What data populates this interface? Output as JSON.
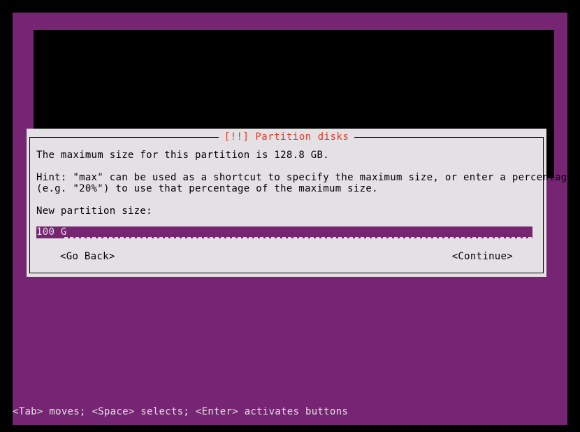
{
  "screen": {
    "background_color": "#762572",
    "frame_color": "#000000"
  },
  "dialog": {
    "title": "[!!] Partition disks",
    "title_color": "#df382c",
    "background_color": "#e4e1e4",
    "text_color": "#000000",
    "body": {
      "line_max_size": "The maximum size for this partition is 128.8 GB.",
      "hint_line_1": "Hint: \"max\" can be used as a shortcut to specify the maximum size, or enter a percentage",
      "hint_line_2": "(e.g. \"20%\") to use that percentage of the maximum size.",
      "prompt_label": "New partition size:"
    },
    "input": {
      "value": "100 G",
      "placeholder": "",
      "field_color": "#762572",
      "value_color": "#e4e1e4"
    },
    "buttons": {
      "go_back": "<Go Back>",
      "continue": "<Continue>"
    }
  },
  "status_bar": {
    "text": "<Tab> moves; <Space> selects; <Enter> activates buttons",
    "text_color": "#e4e1e4"
  }
}
